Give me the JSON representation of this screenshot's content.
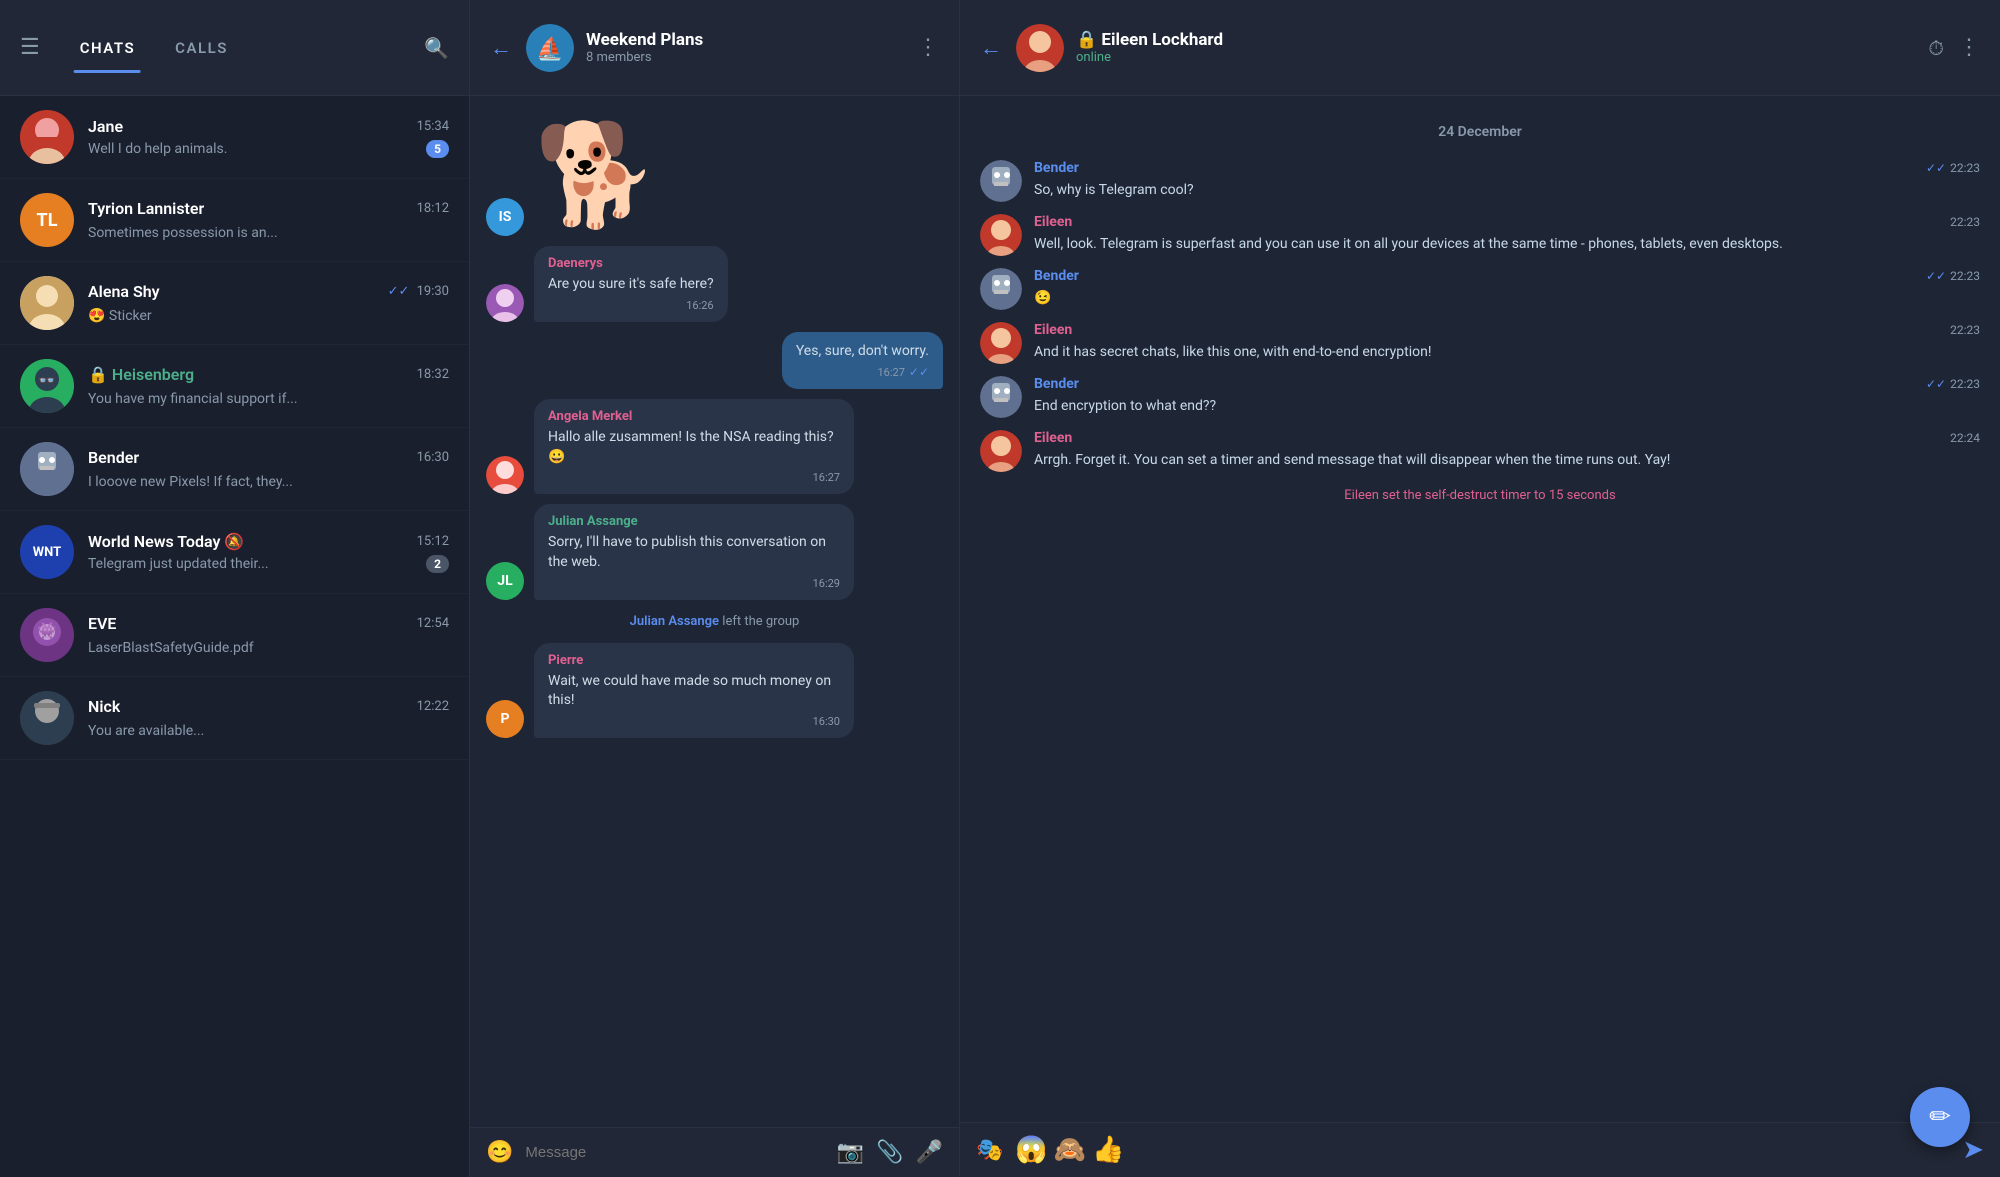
{
  "left": {
    "tabs": [
      "CHATS",
      "CALLS"
    ],
    "active_tab": "CHATS",
    "chats": [
      {
        "id": "jane",
        "name": "Jane",
        "preview": "Well I do help animals.",
        "time": "15:34",
        "badge": "5",
        "badge_color": "blue",
        "avatar_color": "#c0392b",
        "avatar_text": "",
        "avatar_type": "image"
      },
      {
        "id": "tyrion",
        "name": "Tyrion Lannister",
        "preview": "Sometimes possession is an...",
        "time": "18:12",
        "badge": "",
        "avatar_color": "#e67e22",
        "avatar_text": "TL",
        "avatar_type": "initials"
      },
      {
        "id": "alena",
        "name": "Alena Shy",
        "preview": "😍 Sticker",
        "time": "19:30",
        "check": "✓✓",
        "check_color": "blue",
        "avatar_color": "#bdc3c7",
        "avatar_text": "",
        "avatar_type": "image"
      },
      {
        "id": "heisenberg",
        "name": "🔒 Heisenberg",
        "name_color": "green",
        "preview": "You have my financial support if...",
        "time": "18:32",
        "badge": "",
        "avatar_color": "#27ae60",
        "avatar_text": "",
        "avatar_type": "image"
      },
      {
        "id": "bender",
        "name": "Bender",
        "preview": "I looove new Pixels! If fact, they...",
        "time": "16:30",
        "badge": "",
        "avatar_color": "#2980b9",
        "avatar_text": "",
        "avatar_type": "image"
      },
      {
        "id": "worldnews",
        "name": "World News Today 🔕",
        "preview": "Telegram just updated their...",
        "time": "15:12",
        "badge": "2",
        "badge_color": "grey",
        "avatar_color": "#1e40af",
        "avatar_text": "WNT",
        "avatar_type": "initials"
      },
      {
        "id": "eve",
        "name": "EVE",
        "preview": "LaserBlastSafetyGuide.pdf",
        "time": "12:54",
        "badge": "",
        "avatar_color": "#8e44ad",
        "avatar_text": "",
        "avatar_type": "image"
      },
      {
        "id": "nick",
        "name": "Nick",
        "preview": "You are available...",
        "time": "12:22",
        "badge": "",
        "avatar_color": "#2c3e50",
        "avatar_text": "",
        "avatar_type": "image"
      }
    ],
    "fab_icon": "✏"
  },
  "middle": {
    "title": "Weekend Plans",
    "subtitle": "8 members",
    "messages": [
      {
        "id": "sticker1",
        "type": "sticker",
        "sender_initials": "IS",
        "sender_color": "#3498db"
      },
      {
        "id": "m1",
        "type": "incoming",
        "sender": "Daenerys",
        "sender_color": "#e06090",
        "text": "Are you sure it's safe here?",
        "time": "16:26"
      },
      {
        "id": "m2",
        "type": "outgoing",
        "text": "Yes, sure, don't worry.",
        "time": "16:27",
        "check": "✓✓",
        "check_color": "blue"
      },
      {
        "id": "m3",
        "type": "incoming",
        "sender": "Angela Merkel",
        "sender_color": "#e06090",
        "text": "Hallo alle zusammen! Is the NSA reading this? 😀",
        "time": "16:27",
        "avatar_color": "#e74c3c"
      },
      {
        "id": "m4",
        "type": "incoming",
        "sender": "Julian Assange",
        "sender_color": "#4caf8a",
        "text": "Sorry, I'll have to publish this conversation on the web.",
        "time": "16:29",
        "avatar_color": "#27ae60",
        "avatar_initials": "JL"
      },
      {
        "id": "sys1",
        "type": "system",
        "text": "Julian Assange left the group",
        "highlight": "Julian Assange"
      },
      {
        "id": "m5",
        "type": "incoming",
        "sender": "Pierre",
        "sender_color": "#e06090",
        "text": "Wait, we could have made so much money on this!",
        "time": "16:30",
        "avatar_color": "#e67e22",
        "avatar_initials": "P"
      }
    ],
    "input_placeholder": "Message"
  },
  "right": {
    "title": "Eileen Lockhard",
    "lock_icon": "🔒",
    "subtitle": "online",
    "date_divider": "24 December",
    "messages": [
      {
        "id": "r1",
        "sender": "Bender",
        "sender_type": "bender",
        "text": "So, why is Telegram cool?",
        "time": "22:23",
        "check": "✓✓",
        "check_color": "blue"
      },
      {
        "id": "r2",
        "sender": "Eileen",
        "sender_type": "eileen",
        "text": "Well, look. Telegram is superfast and you can use it on all your devices at the same time - phones, tablets, even desktops.",
        "time": "22:23"
      },
      {
        "id": "r3",
        "sender": "Bender",
        "sender_type": "bender",
        "text": "😉",
        "time": "22:23",
        "check": "✓✓",
        "check_color": "blue"
      },
      {
        "id": "r4",
        "sender": "Eileen",
        "sender_type": "eileen",
        "text": "And it has secret chats, like this one, with end-to-end encryption!",
        "time": "22:23"
      },
      {
        "id": "r5",
        "sender": "Bender",
        "sender_type": "bender",
        "text": "End encryption to what end??",
        "time": "22:23",
        "check": "✓✓",
        "check_color": "blue"
      },
      {
        "id": "r6",
        "sender": "Eileen",
        "sender_type": "eileen",
        "text": "Arrgh. Forget it. You can set a timer and send message that will disappear when the time runs out. Yay!",
        "time": "22:24"
      }
    ],
    "system_msg": "Eileen set the self-destruct timer to 15 seconds",
    "bottom_emojis": [
      "😱",
      "🙈",
      "👍"
    ]
  }
}
